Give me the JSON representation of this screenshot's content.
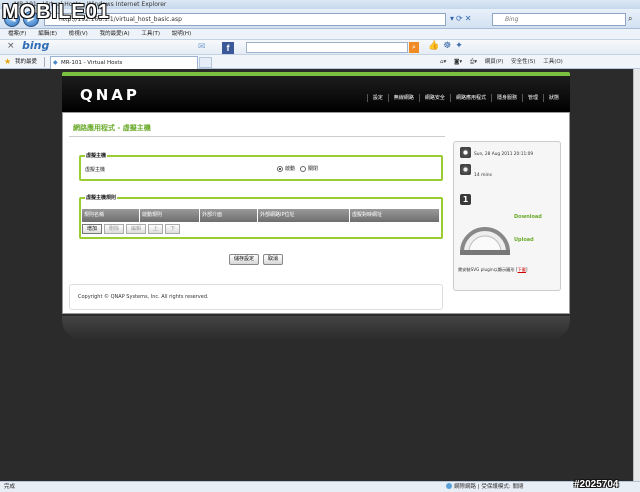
{
  "window": {
    "title": "MR-101 - Virtual Hosts - Windows Internet Explorer"
  },
  "browser": {
    "url": "http://192.168.1.1/virtual_host_basic.asp",
    "search_placeholder": "Bing",
    "menu": [
      "檔案(F)",
      "編輯(E)",
      "檢視(V)",
      "我的最愛(A)",
      "工具(T)",
      "說明(H)"
    ],
    "bing_logo": "bing",
    "favorites_label": "我的最愛",
    "tab_title": "MR-101 - Virtual Hosts",
    "commands": [
      "網頁(P)",
      "安全性(S)",
      "工具(O)"
    ],
    "status_left": "完成",
    "status_right": "網際網路 | 受保護模式: 關閉"
  },
  "brand": {
    "logo": "QNAP",
    "accent": "#7ac142"
  },
  "topnav": [
    "設定",
    "無線網路",
    "網路安全",
    "網路應用程式",
    "隱身服務",
    "管理",
    "狀態"
  ],
  "page": {
    "title": "網路應用程式 - 虛擬主機",
    "vhost": {
      "legend": "虛擬主機",
      "row_label": "虛擬主機",
      "opt_on": "啟動",
      "opt_off": "關閉",
      "selected": "啟動"
    },
    "rules": {
      "legend": "虛擬主機規則",
      "columns": [
        "規則名稱",
        "啟動規則",
        "外部介面",
        "外部網路IP位址",
        "虛擬對映網址"
      ],
      "buttons": [
        "增加",
        "刪除",
        "編輯",
        "上",
        "下"
      ]
    },
    "save_label": "儲存設定",
    "cancel_label": "取消",
    "copyright": "Copyright © QNAP Systems, Inc. All rights reserved."
  },
  "side": {
    "datetime": "Sun, 28 Aug 2011 20:11:09",
    "uptime": "14 mins",
    "download_label": "Download",
    "upload_label": "Upload",
    "plugin_note": "需安裝SVG plugin以顯示圖形",
    "plugin_link": "下載"
  },
  "watermark": {
    "logo": "MOBILE01",
    "id": "#2025704"
  }
}
